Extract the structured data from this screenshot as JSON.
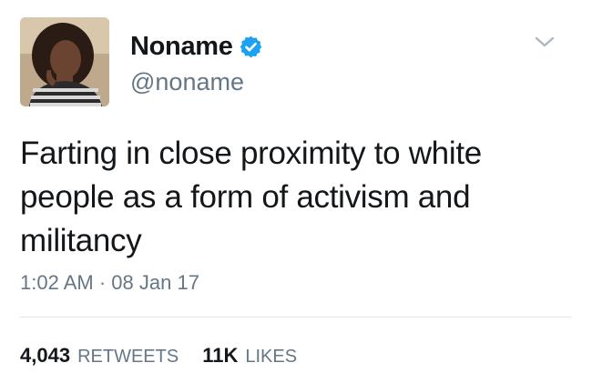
{
  "user": {
    "display_name": "Noname",
    "handle": "@noname",
    "verified_icon": "verified-badge-icon",
    "avatar_icon": "profile-photo"
  },
  "menu": {
    "icon": "chevron-down-icon"
  },
  "tweet": {
    "text": "Farting in close proximity to white people as a form of activism and militancy",
    "time": "1:02 AM",
    "separator": "·",
    "date": "08 Jan 17"
  },
  "stats": {
    "retweets_count": "4,043",
    "retweets_label": "RETWEETS",
    "likes_count": "11K",
    "likes_label": "LIKES"
  },
  "colors": {
    "text": "#14171a",
    "secondary": "#657786",
    "verified_blue": "#1da1f2",
    "divider": "#e1e8ed"
  }
}
